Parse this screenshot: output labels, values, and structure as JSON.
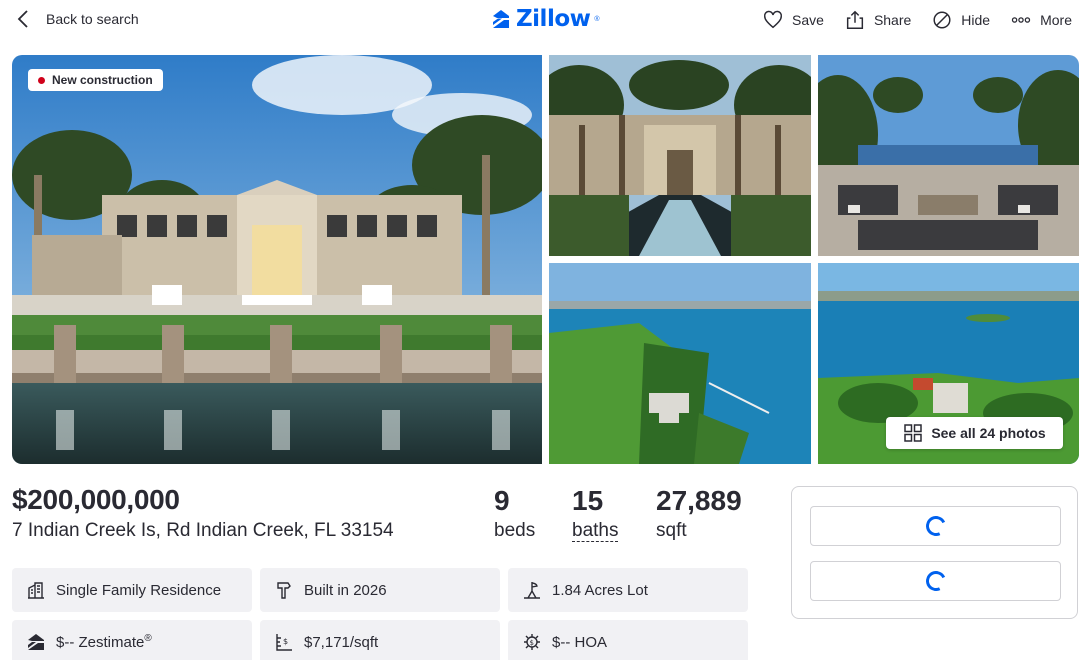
{
  "header": {
    "back_label": "Back to search",
    "logo_text": "Zillow",
    "logo_color": "#0061ee",
    "actions": [
      {
        "icon": "heart-icon",
        "label": "Save"
      },
      {
        "icon": "share-icon",
        "label": "Share"
      },
      {
        "icon": "hide-icon",
        "label": "Hide"
      },
      {
        "icon": "more-icon",
        "label": "More"
      }
    ]
  },
  "gallery": {
    "badge": "New construction",
    "badge_dot_color": "#d0021b",
    "see_all_label": "See all 24 photos"
  },
  "listing": {
    "price": "$200,000,000",
    "address": "7 Indian Creek Is, Rd Indian Creek, FL 33154",
    "beds": "9",
    "beds_label": "beds",
    "baths": "15",
    "baths_label": "baths",
    "sqft": "27,889",
    "sqft_label": "sqft"
  },
  "facts": [
    {
      "icon": "building-icon",
      "text": "Single Family Residence"
    },
    {
      "icon": "hammer-icon",
      "text": "Built in 2026"
    },
    {
      "icon": "lot-icon",
      "text": "1.84 Acres Lot"
    },
    {
      "icon": "zestimate-icon",
      "text": "$-- Zestimate",
      "sup": "®"
    },
    {
      "icon": "price-per-sqft-icon",
      "text": "$7,171/sqft"
    },
    {
      "icon": "hoa-icon",
      "text": "$-- HOA"
    }
  ]
}
